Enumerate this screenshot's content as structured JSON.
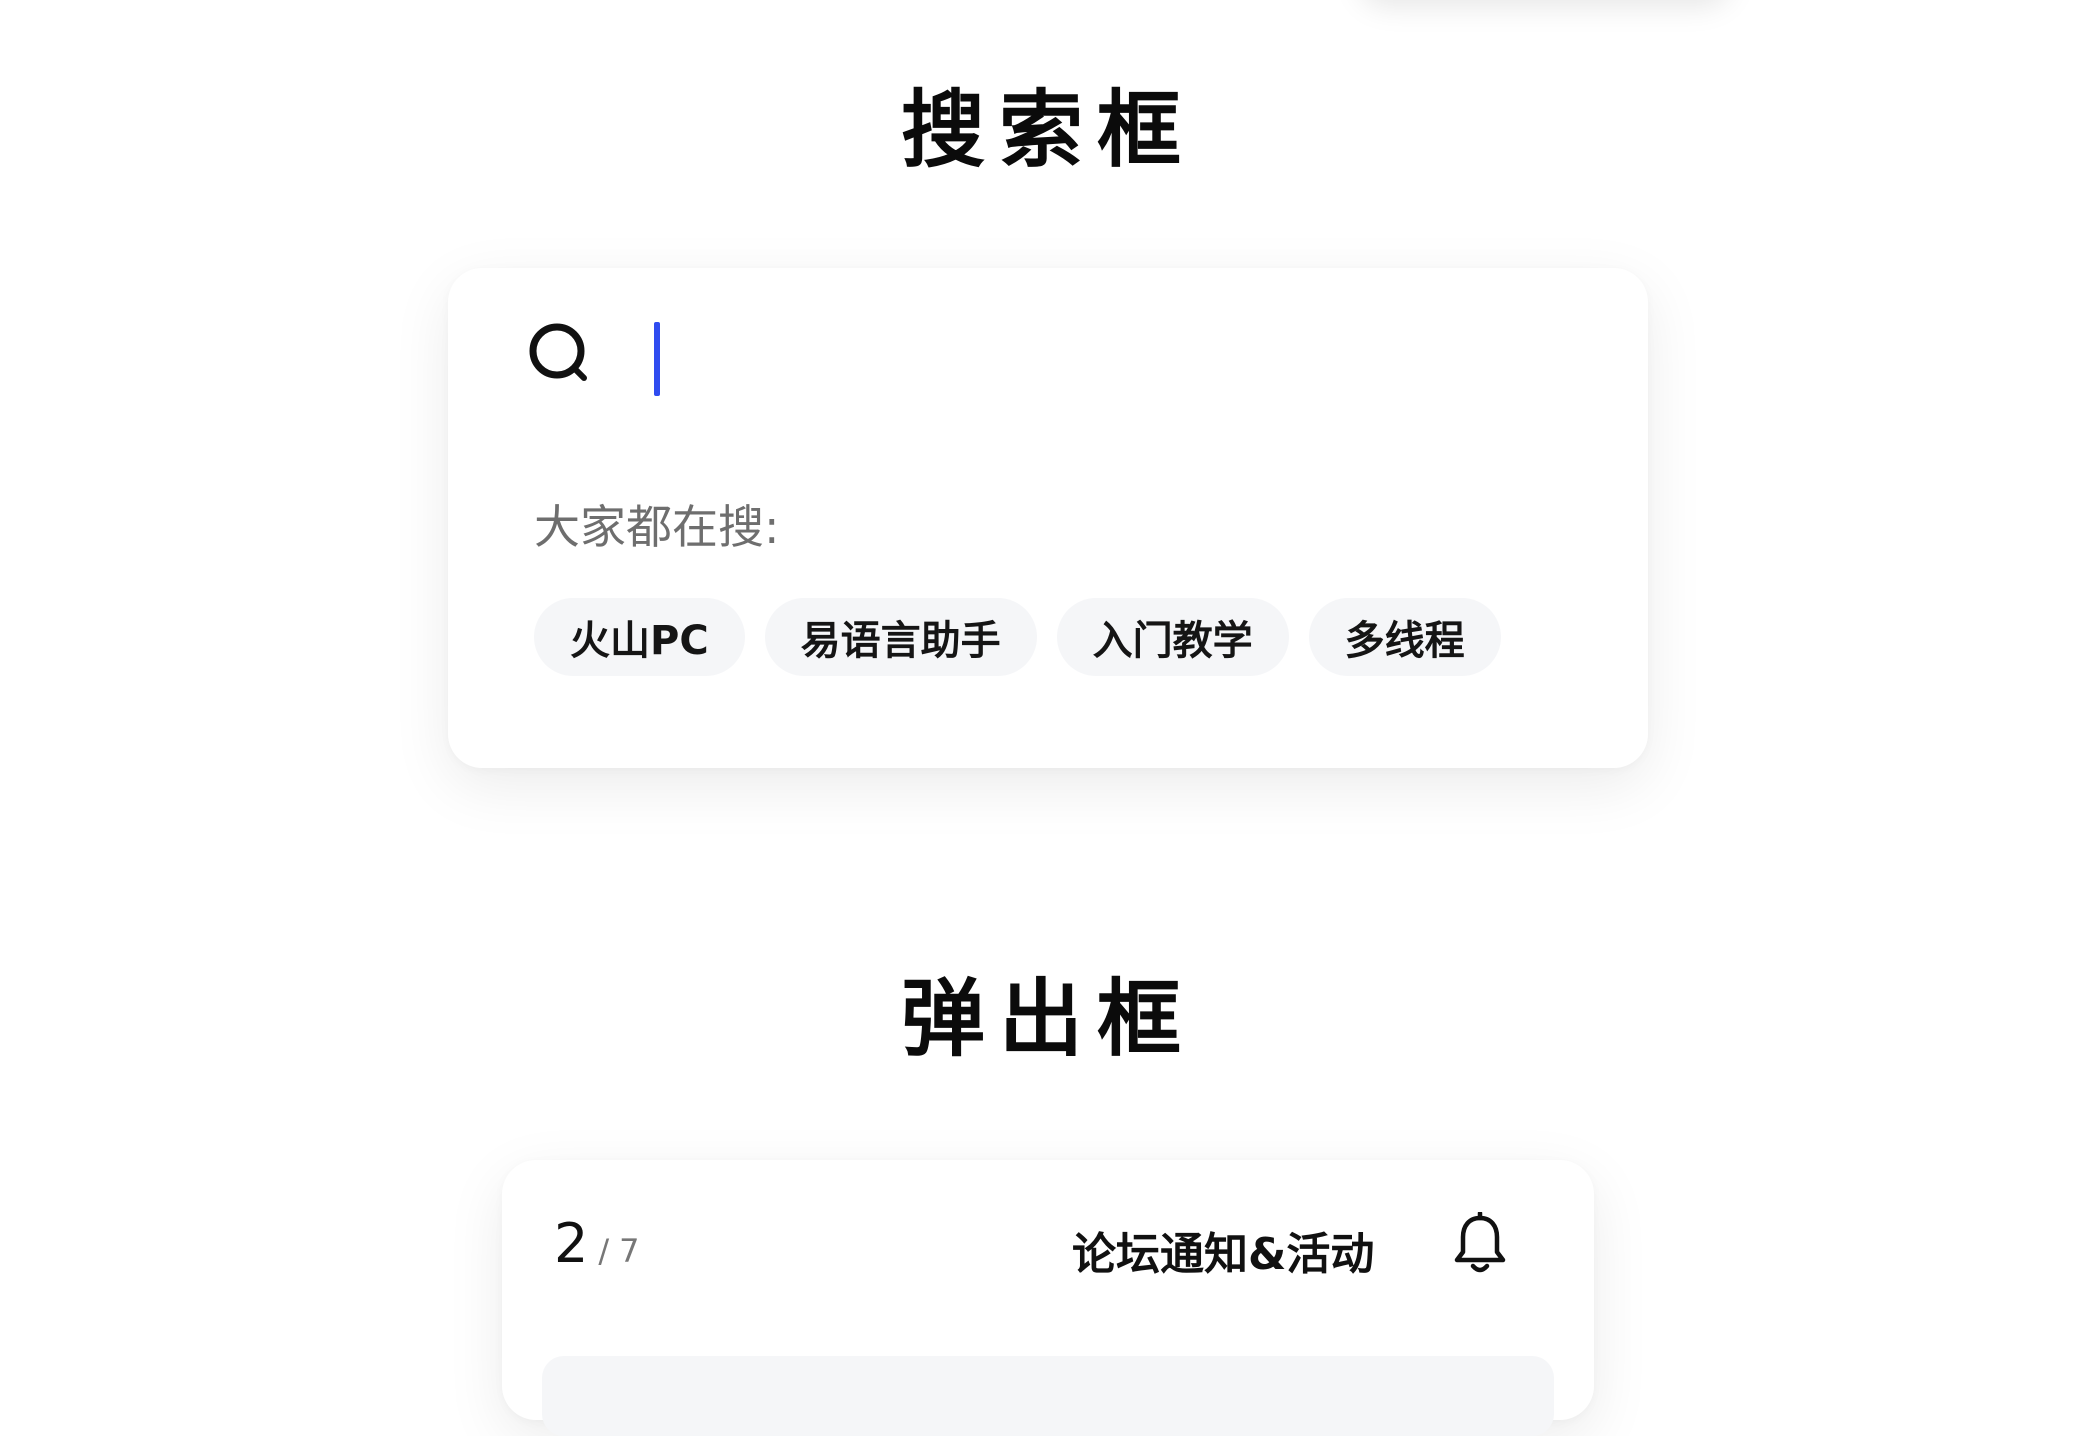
{
  "search_section": {
    "title": "搜索框",
    "input_value": "",
    "hot_label": "大家都在搜:",
    "tags": [
      "火山PC",
      "易语言助手",
      "入门教学",
      "多线程"
    ],
    "caret_color": "#2f4cf0"
  },
  "popup_section": {
    "title": "弹出框",
    "pager_current": "2",
    "pager_separator": "/",
    "pager_total": "7",
    "notice_title": "论坛通知&活动",
    "icon": "bell-icon"
  },
  "colors": {
    "background": "#ffffff",
    "tag_background": "#f5f6f8",
    "muted_text": "#6e6e6e"
  }
}
